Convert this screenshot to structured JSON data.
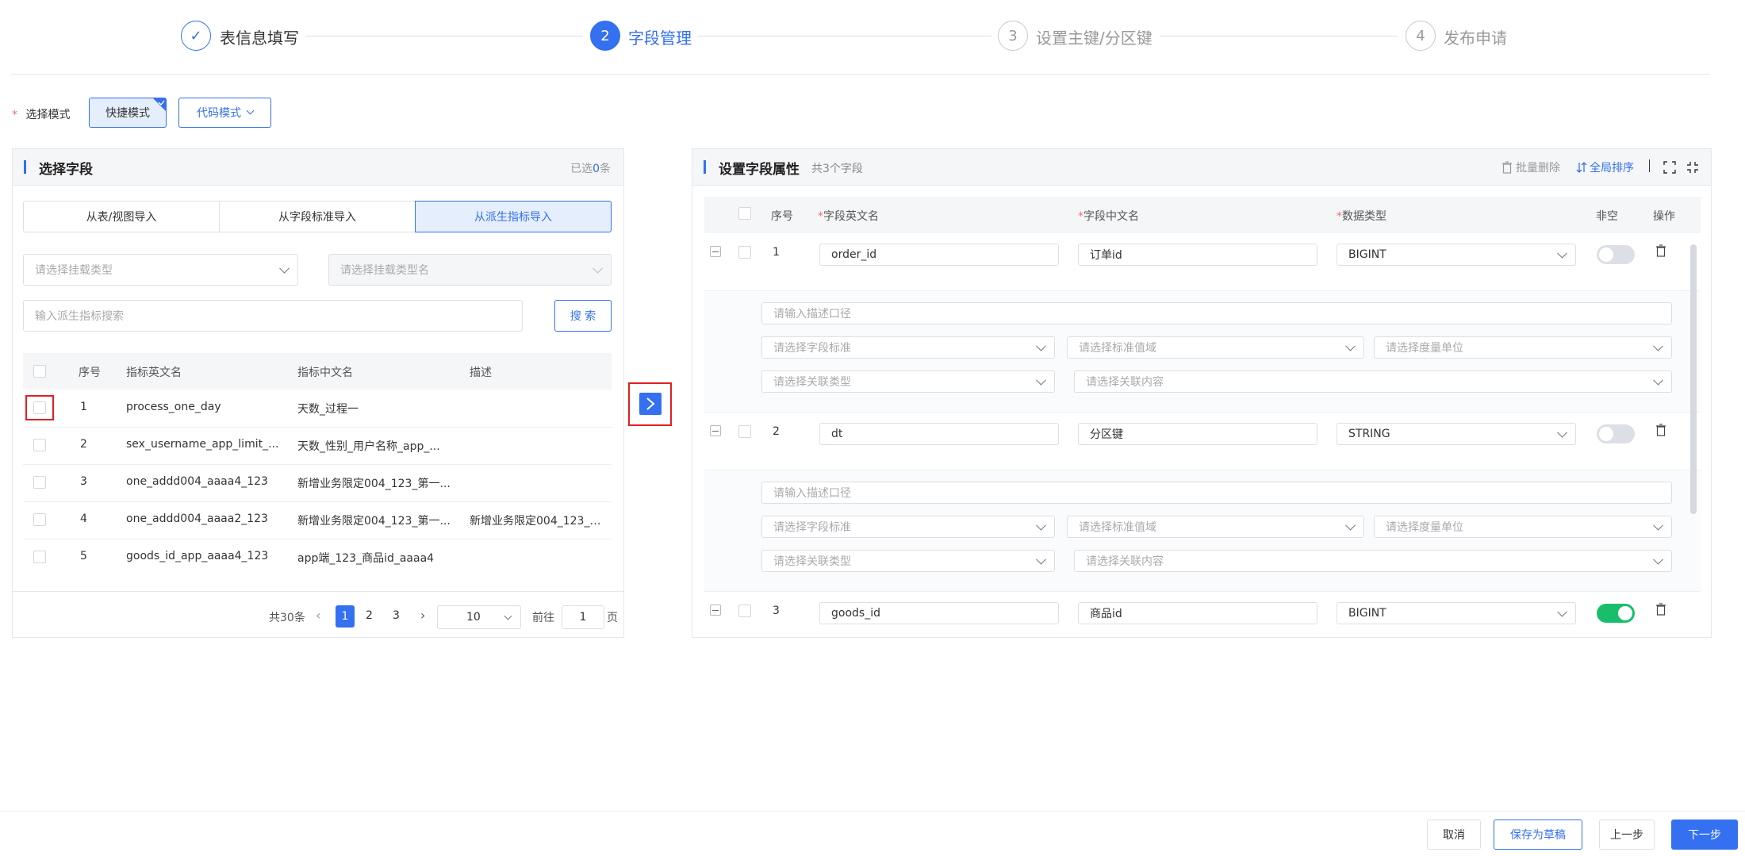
{
  "steps": [
    {
      "num": "✓",
      "label": "表信息填写",
      "state": "done"
    },
    {
      "num": "2",
      "label": "字段管理",
      "state": "active"
    },
    {
      "num": "3",
      "label": "设置主键/分区键",
      "state": "pending"
    },
    {
      "num": "4",
      "label": "发布申请",
      "state": "pending"
    }
  ],
  "mode": {
    "required_mark": "*",
    "label": "选择模式",
    "quick": "快捷模式",
    "code": "代码模式"
  },
  "left_panel": {
    "title": "选择字段",
    "selected_prefix": "已选",
    "selected_count": "0",
    "selected_suffix": "条",
    "tabs": [
      "从表/视图导入",
      "从字段标准导入",
      "从派生指标导入"
    ],
    "active_tab": 2,
    "mount_type_placeholder": "请选择挂载类型",
    "mount_name_placeholder": "请选择挂载类型名",
    "search_placeholder": "输入派生指标搜索",
    "search_button": "搜 索",
    "columns": {
      "index": "序号",
      "en_name": "指标英文名",
      "cn_name": "指标中文名",
      "desc": "描述"
    },
    "rows": [
      {
        "index": "1",
        "en_name": "process_one_day",
        "cn_name": "天数_过程一",
        "desc": ""
      },
      {
        "index": "2",
        "en_name": "sex_username_app_limit_...",
        "cn_name": "天数_性别_用户名称_app_...",
        "desc": ""
      },
      {
        "index": "3",
        "en_name": "one_addd004_aaaa4_123",
        "cn_name": "新增业务限定004_123_第一...",
        "desc": ""
      },
      {
        "index": "4",
        "en_name": "one_addd004_aaaa2_123",
        "cn_name": "新增业务限定004_123_第一...",
        "desc": "新增业务限定004_123_第..."
      },
      {
        "index": "5",
        "en_name": "goods_id_app_aaaa4_123",
        "cn_name": "app端_123_商品id_aaaa4",
        "desc": ""
      }
    ],
    "pagination": {
      "total": "共30条",
      "pages": [
        "1",
        "2",
        "3"
      ],
      "current": "1",
      "page_size": "10",
      "goto_label": "前往",
      "goto_value": "1",
      "goto_suffix": "页"
    }
  },
  "right_panel": {
    "title": "设置字段属性",
    "count_text": "共3个字段",
    "batch_delete": "批量删除",
    "global_sort": "全局排序",
    "columns": {
      "index": "序号",
      "en_name": "字段英文名",
      "cn_name": "字段中文名",
      "type": "数据类型",
      "not_null": "非空",
      "ops": "操作"
    },
    "required_mark": "*",
    "fields": [
      {
        "index": "1",
        "en_name": "order_id",
        "cn_name": "订单id",
        "type": "BIGINT",
        "not_null": false
      },
      {
        "index": "2",
        "en_name": "dt",
        "cn_name": "分区键",
        "type": "STRING",
        "not_null": false
      },
      {
        "index": "3",
        "en_name": "goods_id",
        "cn_name": "商品id",
        "type": "BIGINT",
        "not_null": true
      }
    ],
    "detail_placeholders": {
      "desc": "请输入描述口径",
      "standard": "请选择字段标准",
      "value_domain": "请选择标准值域",
      "unit": "请选择度量单位",
      "relation_type": "请选择关联类型",
      "relation_content": "请选择关联内容"
    }
  },
  "footer": {
    "cancel": "取消",
    "save_draft": "保存为草稿",
    "prev": "上一步",
    "next": "下一步"
  },
  "colors": {
    "primary": "#3470f0",
    "toggle_on": "#19be6b",
    "highlight": "#e02020"
  }
}
